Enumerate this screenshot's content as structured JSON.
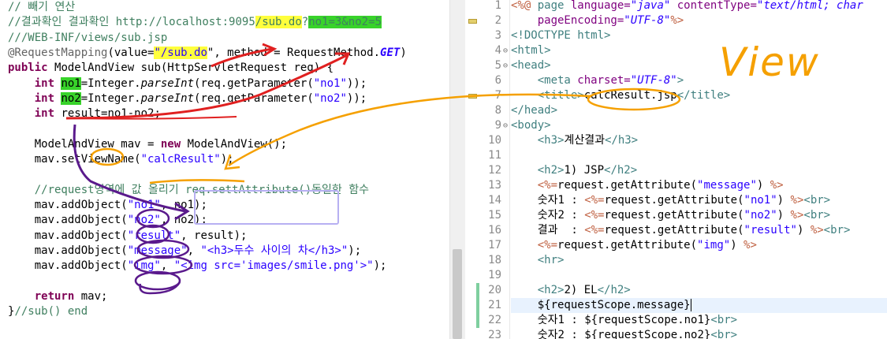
{
  "left_editor": {
    "lines": [
      [
        {
          "t": "// 빼기 연산",
          "c": "cm"
        }
      ],
      [
        {
          "t": "//결과확인 결과확인 http://localhost:9095",
          "c": "cm"
        },
        {
          "t": "/sub.do",
          "c": "cm hl-y"
        },
        {
          "t": "?",
          "c": "cm"
        },
        {
          "t": "no1=3&no2=5",
          "c": "cm hl-g"
        }
      ],
      [
        {
          "t": "///WEB-INF/views/sub.jsp",
          "c": "cm"
        }
      ],
      [
        {
          "t": "@RequestMapping",
          "c": "an"
        },
        {
          "t": "(value=",
          "c": ""
        },
        {
          "t": "\"/sub.do",
          "c": "st hl-y"
        },
        {
          "t": "\", method = RequestMethod.",
          "c": ""
        },
        {
          "t": "GET",
          "c": "stb"
        },
        {
          "t": ")",
          "c": ""
        }
      ],
      [
        {
          "t": "public ",
          "c": "kw"
        },
        {
          "t": "ModelAndView sub(HttpServletRequest req) {",
          "c": ""
        }
      ],
      [
        {
          "t": "    ",
          "c": ""
        },
        {
          "t": "int ",
          "c": "kw"
        },
        {
          "t": "no1",
          "c": "hl-g"
        },
        {
          "t": "=Integer.",
          "c": ""
        },
        {
          "t": "parseInt",
          "c": "it"
        },
        {
          "t": "(req.getParameter(",
          "c": ""
        },
        {
          "t": "\"no1\"",
          "c": "st"
        },
        {
          "t": "));",
          "c": ""
        }
      ],
      [
        {
          "t": "    ",
          "c": ""
        },
        {
          "t": "int ",
          "c": "kw"
        },
        {
          "t": "no2",
          "c": "hl-g"
        },
        {
          "t": "=Integer.",
          "c": ""
        },
        {
          "t": "parseInt",
          "c": "it"
        },
        {
          "t": "(req.getParameter(",
          "c": ""
        },
        {
          "t": "\"no2\"",
          "c": "st"
        },
        {
          "t": "));",
          "c": ""
        }
      ],
      [
        {
          "t": "    ",
          "c": ""
        },
        {
          "t": "int ",
          "c": "kw"
        },
        {
          "t": "result=no1-no2;",
          "c": ""
        }
      ],
      [
        {
          "t": "",
          "c": ""
        }
      ],
      [
        {
          "t": "    ModelAndView mav = ",
          "c": ""
        },
        {
          "t": "new ",
          "c": "kw"
        },
        {
          "t": "ModelAndView();",
          "c": ""
        }
      ],
      [
        {
          "t": "    mav.setViewName(",
          "c": ""
        },
        {
          "t": "\"calcResult\"",
          "c": "st"
        },
        {
          "t": ");",
          "c": ""
        }
      ],
      [
        {
          "t": "",
          "c": ""
        }
      ],
      [
        {
          "t": "    //request영역에 값 올리기 req.settAttribute()동일한 함수",
          "c": "cm"
        }
      ],
      [
        {
          "t": "    mav.addObject(",
          "c": ""
        },
        {
          "t": "\"no1\"",
          "c": "st"
        },
        {
          "t": ", no1);",
          "c": ""
        }
      ],
      [
        {
          "t": "    mav.addObject(",
          "c": ""
        },
        {
          "t": "\"no2\"",
          "c": "st"
        },
        {
          "t": ", no2);",
          "c": ""
        }
      ],
      [
        {
          "t": "    mav.addObject(",
          "c": ""
        },
        {
          "t": "\"result\"",
          "c": "st"
        },
        {
          "t": ", result);",
          "c": ""
        }
      ],
      [
        {
          "t": "    mav.addObject(",
          "c": ""
        },
        {
          "t": "\"message\"",
          "c": "st"
        },
        {
          "t": ", ",
          "c": ""
        },
        {
          "t": "\"<h3>두수 사이의 차</h3>\"",
          "c": "st"
        },
        {
          "t": ");",
          "c": ""
        }
      ],
      [
        {
          "t": "    mav.addObject(",
          "c": ""
        },
        {
          "t": "\"img\"",
          "c": "st"
        },
        {
          "t": ", ",
          "c": ""
        },
        {
          "t": "\"<img src='images/smile.png'>\"",
          "c": "st"
        },
        {
          "t": ");",
          "c": ""
        }
      ],
      [
        {
          "t": "",
          "c": ""
        }
      ],
      [
        {
          "t": "    ",
          "c": ""
        },
        {
          "t": "return ",
          "c": "kw"
        },
        {
          "t": "mav;",
          "c": ""
        }
      ],
      [
        {
          "t": "}",
          "c": ""
        },
        {
          "t": "//sub() end",
          "c": "cm"
        }
      ]
    ]
  },
  "right_editor": {
    "line_numbers": [
      "1",
      "2",
      "3",
      "4",
      "5",
      "6",
      "7",
      "8",
      "9",
      "10",
      "11",
      "12",
      "13",
      "14",
      "15",
      "16",
      "17",
      "18",
      "19",
      "20",
      "21",
      "22",
      "23"
    ],
    "current_line": "21",
    "lines": [
      [
        {
          "t": "<%@ ",
          "c": "jsp"
        },
        {
          "t": "page ",
          "c": "tg"
        },
        {
          "t": "language=",
          "c": "at"
        },
        {
          "t": "\"java\" ",
          "c": "av"
        },
        {
          "t": "contentType=",
          "c": "at"
        },
        {
          "t": "\"text/html; char",
          "c": "av"
        }
      ],
      [
        {
          "t": "    ",
          "c": ""
        },
        {
          "t": "pageEncoding=",
          "c": "at"
        },
        {
          "t": "\"UTF-8\"",
          "c": "av"
        },
        {
          "t": "%>",
          "c": "jsp"
        }
      ],
      [
        {
          "t": "<!DOCTYPE html>",
          "c": "tg"
        }
      ],
      [
        {
          "t": "<html>",
          "c": "tg"
        }
      ],
      [
        {
          "t": "<head>",
          "c": "tg"
        }
      ],
      [
        {
          "t": "    ",
          "c": ""
        },
        {
          "t": "<meta ",
          "c": "tg"
        },
        {
          "t": "charset=",
          "c": "at"
        },
        {
          "t": "\"UTF-8\"",
          "c": "av"
        },
        {
          "t": ">",
          "c": "tg"
        }
      ],
      [
        {
          "t": "    ",
          "c": ""
        },
        {
          "t": "<title>",
          "c": "tg"
        },
        {
          "t": "calcResult.jsp",
          "c": ""
        },
        {
          "t": "</title>",
          "c": "tg"
        }
      ],
      [
        {
          "t": "</head>",
          "c": "tg"
        }
      ],
      [
        {
          "t": "<body>",
          "c": "tg"
        }
      ],
      [
        {
          "t": "    ",
          "c": ""
        },
        {
          "t": "<h3>",
          "c": "tg"
        },
        {
          "t": "계산결과",
          "c": ""
        },
        {
          "t": "</h3>",
          "c": "tg"
        }
      ],
      [
        {
          "t": "",
          "c": ""
        }
      ],
      [
        {
          "t": "    ",
          "c": ""
        },
        {
          "t": "<h2>",
          "c": "tg"
        },
        {
          "t": "1) JSP",
          "c": ""
        },
        {
          "t": "</h2>",
          "c": "tg"
        }
      ],
      [
        {
          "t": "    ",
          "c": ""
        },
        {
          "t": "<%=",
          "c": "jsp"
        },
        {
          "t": "request.getAttribute(",
          "c": ""
        },
        {
          "t": "\"message\"",
          "c": "st"
        },
        {
          "t": ") ",
          "c": ""
        },
        {
          "t": "%>",
          "c": "jsp"
        }
      ],
      [
        {
          "t": "    숫자1 : ",
          "c": ""
        },
        {
          "t": "<%=",
          "c": "jsp"
        },
        {
          "t": "request.getAttribute(",
          "c": ""
        },
        {
          "t": "\"no1\"",
          "c": "st"
        },
        {
          "t": ") ",
          "c": ""
        },
        {
          "t": "%>",
          "c": "jsp"
        },
        {
          "t": "<br>",
          "c": "tg"
        }
      ],
      [
        {
          "t": "    숫자2 : ",
          "c": ""
        },
        {
          "t": "<%=",
          "c": "jsp"
        },
        {
          "t": "request.getAttribute(",
          "c": ""
        },
        {
          "t": "\"no2\"",
          "c": "st"
        },
        {
          "t": ") ",
          "c": ""
        },
        {
          "t": "%>",
          "c": "jsp"
        },
        {
          "t": "<br>",
          "c": "tg"
        }
      ],
      [
        {
          "t": "    결과  : ",
          "c": ""
        },
        {
          "t": "<%=",
          "c": "jsp"
        },
        {
          "t": "request.getAttribute(",
          "c": ""
        },
        {
          "t": "\"result\"",
          "c": "st"
        },
        {
          "t": ") ",
          "c": ""
        },
        {
          "t": "%>",
          "c": "jsp"
        },
        {
          "t": "<br>",
          "c": "tg"
        }
      ],
      [
        {
          "t": "    ",
          "c": ""
        },
        {
          "t": "<%=",
          "c": "jsp"
        },
        {
          "t": "request.getAttribute(",
          "c": ""
        },
        {
          "t": "\"img\"",
          "c": "st"
        },
        {
          "t": ") ",
          "c": ""
        },
        {
          "t": "%>",
          "c": "jsp"
        }
      ],
      [
        {
          "t": "    ",
          "c": ""
        },
        {
          "t": "<hr>",
          "c": "tg"
        }
      ],
      [
        {
          "t": "",
          "c": ""
        }
      ],
      [
        {
          "t": "    ",
          "c": ""
        },
        {
          "t": "<h2>",
          "c": "tg"
        },
        {
          "t": "2) EL",
          "c": ""
        },
        {
          "t": "</h2>",
          "c": "tg"
        }
      ],
      [
        {
          "t": "    ${requestScope.message}",
          "c": ""
        }
      ],
      [
        {
          "t": "    숫자1 : ${requestScope.no1}",
          "c": ""
        },
        {
          "t": "<br>",
          "c": "tg"
        }
      ],
      [
        {
          "t": "    숫자2 : ${requestScope.no2}",
          "c": ""
        },
        {
          "t": "<br>",
          "c": "tg"
        }
      ]
    ]
  },
  "annotation": {
    "label": "View",
    "color": "#f5a000"
  },
  "colors": {
    "red_arrow": "#e02020",
    "orange_arrow": "#f5a000",
    "purple_arrow": "#5a1a8c",
    "lavender_box": "#b7b0f2"
  }
}
